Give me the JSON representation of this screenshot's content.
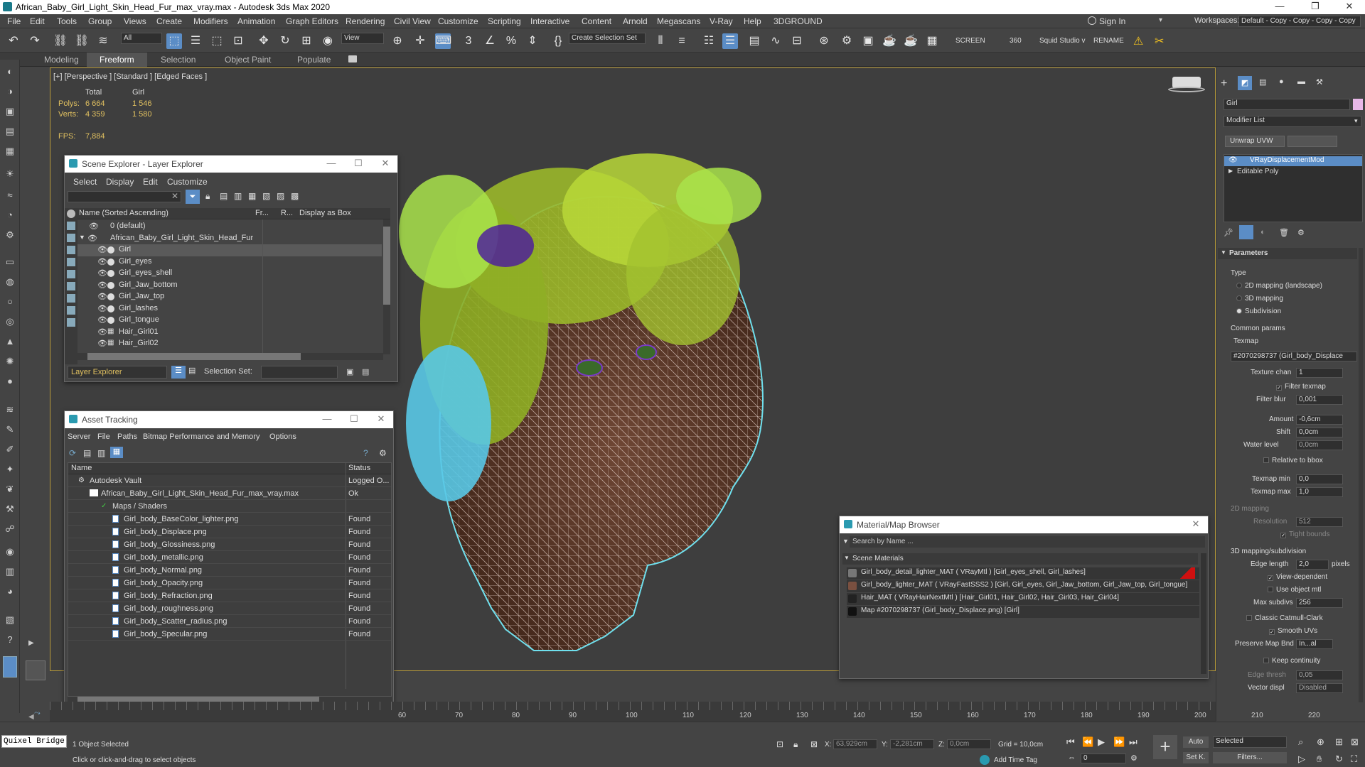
{
  "app": {
    "title": "African_Baby_Girl_Light_Skin_Head_Fur_max_vray.max - Autodesk 3ds Max 2020"
  },
  "menus": [
    "File",
    "Edit",
    "Tools",
    "Group",
    "Views",
    "Create",
    "Modifiers",
    "Animation",
    "Graph Editors",
    "Rendering",
    "Civil View",
    "Customize",
    "Scripting",
    "Interactive",
    "Content",
    "Arnold",
    "Megascans",
    "V-Ray",
    "Help",
    "3DGROUND"
  ],
  "signin": "Sign In",
  "workspaces_label": "Workspaces:",
  "workspace_value": "Default - Copy - Copy - Copy - Copy",
  "toolbar": {
    "filter": "All",
    "view": "View",
    "selection_set": "Create Selection Set",
    "screen": "SCREEN",
    "num360": "360",
    "squid": "Squid Studio v",
    "rename": "RENAME"
  },
  "ribbon_tabs": [
    "Modeling",
    "Freeform",
    "Selection",
    "Object Paint",
    "Populate"
  ],
  "viewport": {
    "label": "[+] [Perspective ] [Standard ] [Edged Faces ]",
    "stats": {
      "total_label": "Total",
      "girl_label": "Girl",
      "polys_label": "Polys:",
      "polys_total": "6 664",
      "polys_girl": "1 546",
      "verts_label": "Verts:",
      "verts_total": "4 359",
      "verts_girl": "1 580",
      "fps_label": "FPS:",
      "fps_value": "7,884"
    }
  },
  "scene_explorer": {
    "title": "Scene Explorer - Layer Explorer",
    "menus": [
      "Select",
      "Display",
      "Edit",
      "Customize"
    ],
    "columns": [
      "Name (Sorted Ascending)",
      "Fr...",
      "R...",
      "Display as Box"
    ],
    "rows": [
      "0 (default)",
      "African_Baby_Girl_Light_Skin_Head_Fur",
      "Girl",
      "Girl_eyes",
      "Girl_eyes_shell",
      "Girl_Jaw_bottom",
      "Girl_Jaw_top",
      "Girl_lashes",
      "Girl_tongue",
      "Hair_Girl01",
      "Hair_Girl02"
    ],
    "footer_layer": "Layer Explorer",
    "selection_set_label": "Selection Set:"
  },
  "asset_tracking": {
    "title": "Asset Tracking",
    "menus": [
      "Server",
      "File",
      "Paths",
      "Bitmap Performance and Memory",
      "Options"
    ],
    "columns": [
      "Name",
      "Status"
    ],
    "rows": [
      {
        "name": "Autodesk Vault",
        "status": "Logged O..."
      },
      {
        "name": "African_Baby_Girl_Light_Skin_Head_Fur_max_vray.max",
        "status": "Ok"
      },
      {
        "name": "Maps / Shaders",
        "status": ""
      },
      {
        "name": "Girl_body_BaseColor_lighter.png",
        "status": "Found"
      },
      {
        "name": "Girl_body_Displace.png",
        "status": "Found"
      },
      {
        "name": "Girl_body_Glossiness.png",
        "status": "Found"
      },
      {
        "name": "Girl_body_metallic.png",
        "status": "Found"
      },
      {
        "name": "Girl_body_Normal.png",
        "status": "Found"
      },
      {
        "name": "Girl_body_Opacity.png",
        "status": "Found"
      },
      {
        "name": "Girl_body_Refraction.png",
        "status": "Found"
      },
      {
        "name": "Girl_body_roughness.png",
        "status": "Found"
      },
      {
        "name": "Girl_body_Scatter_radius.png",
        "status": "Found"
      },
      {
        "name": "Girl_body_Specular.png",
        "status": "Found"
      }
    ]
  },
  "material_browser": {
    "title": "Material/Map Browser",
    "search_placeholder": "Search by Name ...",
    "section": "Scene Materials",
    "rows": [
      "Girl_body_detail_lighter_MAT  ( VRayMtl ) [Girl_eyes_shell, Girl_lashes]",
      "Girl_body_lighter_MAT  ( VRayFastSSS2 ) [Girl, Girl_eyes, Girl_Jaw_bottom, Girl_Jaw_top, Girl_tongue]",
      "Hair_MAT  ( VRayHairNextMtl ) [Hair_Girl01, Hair_Girl02, Hair_Girl03, Hair_Girl04]",
      "Map #2070298737 (Girl_body_Displace.png)  [Girl]"
    ]
  },
  "command_panel": {
    "object_name": "Girl",
    "modifier_list": "Modifier List",
    "unwrap": "Unwrap UVW",
    "stack": [
      "VRayDisplacementMod",
      "Editable Poly"
    ],
    "parameters": "Parameters",
    "type_label": "Type",
    "types": [
      "2D mapping (landscape)",
      "3D mapping",
      "Subdivision"
    ],
    "common_params": "Common params",
    "texmap_label": "Texmap",
    "texmap_value": "#2070298737 (Girl_body_Displace",
    "texture_chan_label": "Texture chan",
    "texture_chan": "1",
    "filter_texmap": "Filter texmap",
    "filter_blur_label": "Filter blur",
    "filter_blur": "0,001",
    "amount_label": "Amount",
    "amount": "-0,6cm",
    "shift_label": "Shift",
    "shift": "0,0cm",
    "water_level_label": "Water level",
    "water_level": "0,0cm",
    "relative_bbox": "Relative to bbox",
    "texmap_min_label": "Texmap min",
    "texmap_min": "0,0",
    "texmap_max_label": "Texmap max",
    "texmap_max": "1,0",
    "mapping2d": "2D mapping",
    "resolution_label": "Resolution",
    "resolution": "512",
    "tight_bounds": "Tight bounds",
    "mapping3d": "3D mapping/subdivision",
    "edge_length_label": "Edge length",
    "edge_length": "2,0",
    "pixels": "pixels",
    "view_dependent": "View-dependent",
    "use_object_mtl": "Use object mtl",
    "max_subdivs_label": "Max subdivs",
    "max_subdivs": "256",
    "classic_cc": "Classic Catmull-Clark",
    "smooth_uvs": "Smooth UVs",
    "preserve_label": "Preserve Map Bnd",
    "preserve": "In...al",
    "keep_continuity": "Keep continuity",
    "edge_thresh_label": "Edge thresh",
    "edge_thresh": "0,05",
    "vector_displ_label": "Vector displ",
    "vector_displ": "Disabled"
  },
  "timeline": {
    "ticks": [
      "60",
      "70",
      "80",
      "90",
      "100",
      "110",
      "120",
      "130",
      "140",
      "150",
      "160",
      "170",
      "180",
      "190",
      "200",
      "210",
      "220"
    ]
  },
  "status": {
    "quixel": "Quixel Bridge",
    "selected": "1 Object Selected",
    "hint": "Click or click-and-drag to select objects",
    "x_label": "X:",
    "x": "63,929cm",
    "y_label": "Y:",
    "y": "-2,281cm",
    "z_label": "Z:",
    "z": "0,0cm",
    "grid": "Grid = 10,0cm",
    "add_time_tag": "Add Time Tag",
    "auto": "Auto",
    "selected_dd": "Selected",
    "setk": "Set K.",
    "filters": "Filters...",
    "frame": "0"
  }
}
